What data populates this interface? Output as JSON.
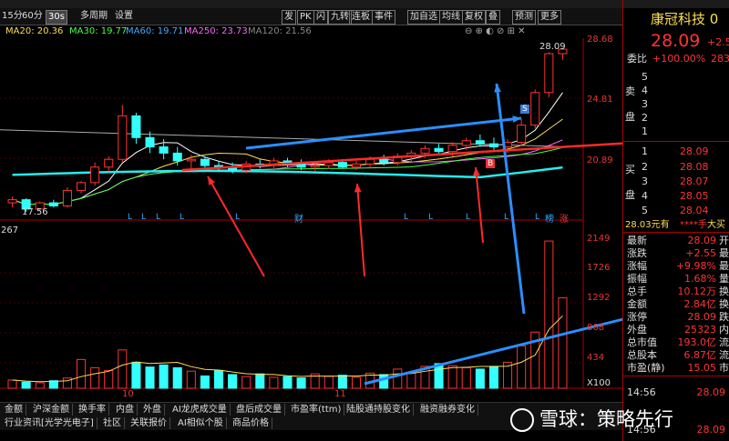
{
  "toolbar": {
    "items": [
      "15分",
      "60分",
      "30s",
      "多周期",
      "设置",
      "发",
      "PK",
      "闪",
      "九转",
      "连板",
      "事件",
      "加自选",
      "均线",
      "复权",
      "叠",
      "预测",
      "更多"
    ],
    "selected": "30s"
  },
  "indicators": {
    "ma20": "MA20: 20.36",
    "ma30": "MA30: 19.77",
    "ma60": "MA60: 19.71",
    "ma250": "MA250: 23.73",
    "ma120": "MA120: 21.56",
    "colors": {
      "ma20": "#ffdd55",
      "ma30": "#44ff44",
      "ma60": "#44aaff",
      "ma250": "#ff66ff",
      "ma120": "#888888"
    }
  },
  "price_axis": {
    "labels": [
      "28.68",
      "24.81",
      "20.89"
    ],
    "top_label": "28.09",
    "low_label": "17.56"
  },
  "volume_axis": {
    "labels": [
      "2149",
      "1726",
      "1292",
      "868",
      "434",
      "X100"
    ],
    "top_left": "267"
  },
  "markers": {
    "s": "S",
    "b": "B",
    "l": "L",
    "cai": "财",
    "bang": "榜",
    "zhang": "涨"
  },
  "x_labels": [
    "10",
    "11"
  ],
  "chart_data": {
    "type": "candlestick",
    "note_levels": "price axis 17.56 to 28.68",
    "candles": [
      [
        18.2,
        18.6,
        17.9,
        18.4
      ],
      [
        18.4,
        18.5,
        17.6,
        17.8
      ],
      [
        17.8,
        18.3,
        17.7,
        18.2
      ],
      [
        18.2,
        18.4,
        17.9,
        18.0
      ],
      [
        18.0,
        19.2,
        17.9,
        19.0
      ],
      [
        19.0,
        19.6,
        18.8,
        19.5
      ],
      [
        19.5,
        20.8,
        19.3,
        20.5
      ],
      [
        20.5,
        21.2,
        20.2,
        21.0
      ],
      [
        21.0,
        24.5,
        20.8,
        23.8
      ],
      [
        23.8,
        24.0,
        22.0,
        22.4
      ],
      [
        22.4,
        22.8,
        21.4,
        21.8
      ],
      [
        21.8,
        22.3,
        21.0,
        21.4
      ],
      [
        21.4,
        21.8,
        20.6,
        20.9
      ],
      [
        20.9,
        21.3,
        20.4,
        21.0
      ],
      [
        21.0,
        21.2,
        20.3,
        20.6
      ],
      [
        20.6,
        20.9,
        20.2,
        20.5
      ],
      [
        20.5,
        20.8,
        20.1,
        20.3
      ],
      [
        20.3,
        20.9,
        20.1,
        20.7
      ],
      [
        20.7,
        21.0,
        20.4,
        20.6
      ],
      [
        20.6,
        21.1,
        20.3,
        20.9
      ],
      [
        20.9,
        21.1,
        20.5,
        20.7
      ],
      [
        20.7,
        21.0,
        20.3,
        20.5
      ],
      [
        20.5,
        20.8,
        20.2,
        20.6
      ],
      [
        20.6,
        21.0,
        20.4,
        20.8
      ],
      [
        20.8,
        21.0,
        20.4,
        20.5
      ],
      [
        20.5,
        20.9,
        20.3,
        20.7
      ],
      [
        20.7,
        21.2,
        20.5,
        21.0
      ],
      [
        21.0,
        21.3,
        20.6,
        20.8
      ],
      [
        20.8,
        21.4,
        20.6,
        21.2
      ],
      [
        21.2,
        21.6,
        20.9,
        21.4
      ],
      [
        21.4,
        21.9,
        21.1,
        21.7
      ],
      [
        21.7,
        22.0,
        21.3,
        21.5
      ],
      [
        21.5,
        22.1,
        21.2,
        21.9
      ],
      [
        21.9,
        22.4,
        21.6,
        22.2
      ],
      [
        22.2,
        22.6,
        21.8,
        22.0
      ],
      [
        22.0,
        22.4,
        21.6,
        21.8
      ],
      [
        21.8,
        22.3,
        21.4,
        22.1
      ],
      [
        22.1,
        23.6,
        21.9,
        23.2
      ],
      [
        23.2,
        25.5,
        23.0,
        25.3
      ],
      [
        25.3,
        27.9,
        25.0,
        27.8
      ],
      [
        27.8,
        28.09,
        27.4,
        28.09
      ]
    ],
    "volumes": [
      120,
      90,
      80,
      110,
      150,
      420,
      300,
      260,
      560,
      380,
      310,
      340,
      300,
      250,
      180,
      260,
      200,
      170,
      210,
      160,
      170,
      150,
      210,
      180,
      190,
      160,
      220,
      200,
      280,
      220,
      320,
      360,
      330,
      300,
      280,
      320,
      380,
      620,
      820,
      2149,
      1320
    ]
  },
  "right_panel": {
    "name": "康冠科技 0",
    "price": "28.09",
    "change": "+2.5",
    "weibi": "委比",
    "weibi_val": "+100.00%",
    "weibi_val2": "283",
    "sell_label": "卖",
    "sell_label2": "盘",
    "buy_label": "买",
    "buy_label2": "盘",
    "asks": [
      "5",
      "4",
      "3",
      "2",
      "1"
    ],
    "bids": [
      {
        "n": "1",
        "p": "28.09"
      },
      {
        "n": "2",
        "p": "28.08"
      },
      {
        "n": "3",
        "p": "28.07"
      },
      {
        "n": "4",
        "p": "28.05"
      },
      {
        "n": "5",
        "p": "28.04"
      }
    ],
    "mid_row": {
      "a": "28.03元有",
      "b": "****手",
      "c": "大买"
    },
    "stats": [
      {
        "k": "最新",
        "v": "28.09",
        "u": "开"
      },
      {
        "k": "涨跌",
        "v": "+2.55",
        "u": "最"
      },
      {
        "k": "涨幅",
        "v": "+9.98%",
        "u": "最"
      },
      {
        "k": "振幅",
        "v": "1.68%",
        "u": "量"
      },
      {
        "k": "总手",
        "v": "10.12万",
        "u": "换"
      },
      {
        "k": "金额",
        "v": "2.84亿",
        "u": "换"
      },
      {
        "k": "涨停",
        "v": "28.09",
        "u": "跌"
      },
      {
        "k": "外盘",
        "v": "25323",
        "u": "内"
      },
      {
        "k": "总市值",
        "v": "193.0亿",
        "u": "流"
      },
      {
        "k": "总股本",
        "v": "6.87亿",
        "u": "流"
      },
      {
        "k": "市盈(静)",
        "v": "15.05",
        "u": "市"
      }
    ],
    "ticks": [
      {
        "t": "14:56",
        "p": "28.09"
      },
      {
        "t": "14:56",
        "p": "28.09"
      }
    ]
  },
  "bottom_tabs": [
    "金额",
    "沪深金额",
    "换手率",
    "内盘",
    "外盘",
    "AI龙虎成交量",
    "盘后成交量",
    "市盈率(ttm)",
    "陆股通持股变化",
    "融资融券变化"
  ],
  "bottom_tabs2": [
    "行业资讯[光学光电子]",
    "社区",
    "关联报价",
    "AI相似个股",
    "商品价格"
  ],
  "watermark": "雪球：策略先行"
}
